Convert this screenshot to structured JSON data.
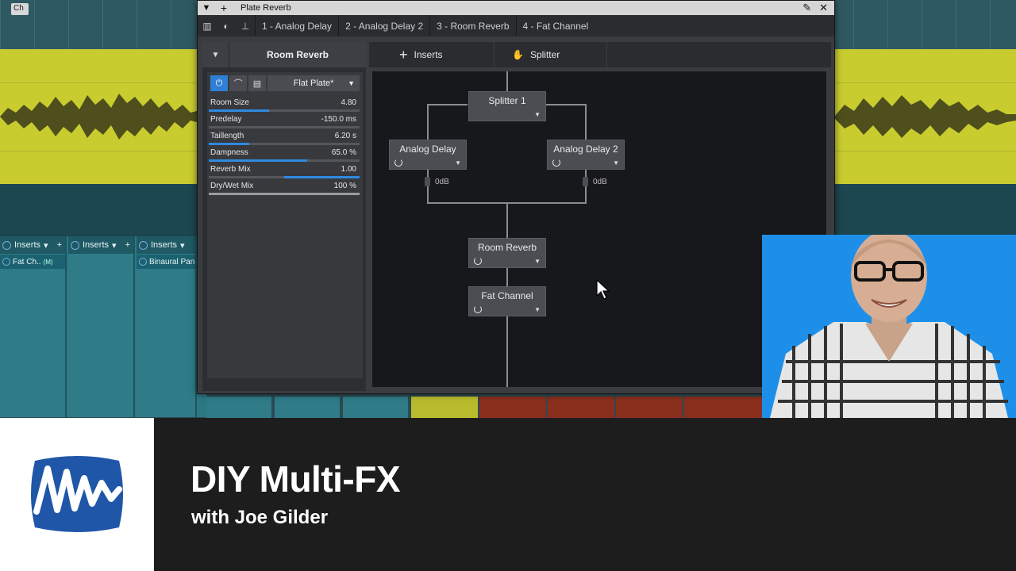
{
  "daw": {
    "channel_label": "Ch",
    "mixer_strips": [
      {
        "header": "Inserts",
        "slot": "Fat Ch..",
        "slot_badge": "(M)"
      },
      {
        "header": "Inserts",
        "slot": ""
      },
      {
        "header": "Inserts",
        "slot": "Binaural Pan"
      }
    ]
  },
  "plugin_window": {
    "title": "Plate Reverb",
    "tabs": [
      "1 - Analog Delay",
      "2 - Analog Delay 2",
      "3 - Room Reverb",
      "4 - Fat Channel"
    ],
    "selected_device": "Room Reverb",
    "preset": "Flat Plate*",
    "params": [
      {
        "name": "Room Size",
        "value": "4.80",
        "level": 0.4
      },
      {
        "name": "Predelay",
        "value": "-150.0 ms",
        "level": 0.0
      },
      {
        "name": "Taillength",
        "value": "6.20 s",
        "level": 0.27
      },
      {
        "name": "Dampness",
        "value": "65.0 %",
        "level": 0.65
      },
      {
        "name": "Reverb Mix",
        "value": "1.00",
        "level_from": 0.5,
        "level": 1.0
      },
      {
        "name": "Dry/Wet Mix",
        "value": "100 %",
        "level": 1.0
      }
    ],
    "routing_header": {
      "inserts_label": "Inserts",
      "splitter_label": "Splitter"
    },
    "nodes": {
      "splitter": "Splitter 1",
      "delay_left": "Analog Delay",
      "delay_right": "Analog Delay 2",
      "reverb": "Room Reverb",
      "fat": "Fat Channel"
    },
    "gain_left": "0dB",
    "gain_right": "0dB"
  },
  "lower_third": {
    "title": "DIY Multi-FX",
    "subtitle": "with Joe Gilder"
  },
  "colors": {
    "accent_blue": "#2f7fd6",
    "clip_yellow": "#c9cc2f",
    "presenter_bg": "#1e8fe8"
  }
}
